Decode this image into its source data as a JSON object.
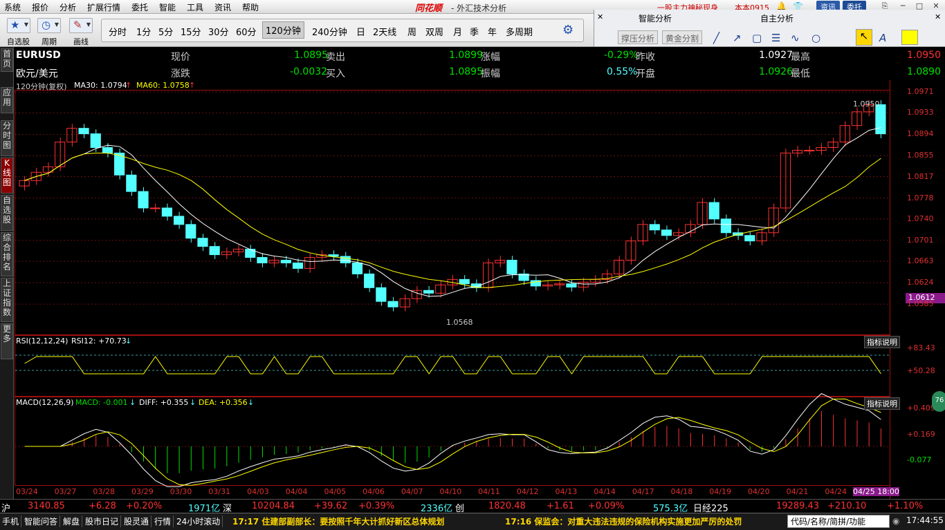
{
  "menu": [
    "系统",
    "报价",
    "分析",
    "扩展行情",
    "委托",
    "智能",
    "工具",
    "资讯",
    "帮助"
  ],
  "brand": "同花顺",
  "window_title": "- 外汇技术分析",
  "promo": "一股主力神秘现身",
  "user": "本本0915",
  "top_buttons": {
    "news": "资讯",
    "trade": "委托"
  },
  "toolbar": {
    "watch": "自选股",
    "period": "周期",
    "draw": "画线"
  },
  "periods": [
    "分时",
    "1分",
    "5分",
    "15分",
    "30分",
    "60分",
    "120分钟",
    "240分钟",
    "日",
    "2天线",
    "周",
    "双周",
    "月",
    "季",
    "年",
    "多周期"
  ],
  "active_period": "120分钟",
  "right_panel": {
    "smart": "智能分析",
    "self": "自主分析",
    "btn1": "撑压分析",
    "btn2": "黄金分割"
  },
  "sidebar": [
    "首页",
    "应用",
    "分时图",
    "K线图",
    "自选股",
    "综合排名",
    "上证指数",
    "更多"
  ],
  "quote": {
    "symbol": "EURUSD",
    "name": "欧元/美元",
    "l_now": "现价",
    "now": "1.0895",
    "l_sell": "卖出",
    "sell": "1.0899",
    "l_chg": "涨幅",
    "chg": "-0.29%",
    "l_prev": "昨收",
    "prev": "1.0927",
    "l_high": "最高",
    "high": "1.0950",
    "l_diff": "涨跌",
    "diff": "-0.0032",
    "l_buy": "买入",
    "buy": "1.0895",
    "l_amp": "振幅",
    "amp": "0.55%",
    "l_open": "开盘",
    "open": "1.0926",
    "l_low": "最低",
    "low": "1.0890"
  },
  "chart": {
    "period_label": "120分钟(复权)",
    "ma30": "MA30: 1.0794",
    "ma60": "MA60: 1.0758",
    "hi_label": "1.0950",
    "lo_label": "1.0568",
    "current_price": "1.0612",
    "colors": {
      "up": "#ff3232",
      "down": "#54ffff",
      "ma30": "#ffffff",
      "ma60": "#ffff00"
    }
  },
  "chart_data": {
    "type": "candlestick",
    "yticks": [
      "1.0971",
      "1.0933",
      "1.0894",
      "1.0855",
      "1.0817",
      "1.0778",
      "1.0740",
      "1.0701",
      "1.0663",
      "1.0624",
      "1.0585"
    ],
    "xticks": [
      "03/24",
      "03/27",
      "03/28",
      "03/29",
      "03/30",
      "03/31",
      "04/03",
      "04/04",
      "04/05",
      "04/06",
      "04/07",
      "04/10",
      "04/11",
      "04/12",
      "04/13",
      "04/14",
      "04/17",
      "04/18",
      "04/19",
      "04/20",
      "04/21",
      "04/24",
      "04/25 18:00"
    ],
    "ylim": [
      1.055,
      1.0975
    ],
    "close": [
      1.081,
      1.0825,
      1.0835,
      1.088,
      1.0905,
      1.0895,
      1.087,
      1.086,
      1.082,
      1.079,
      1.076,
      1.076,
      1.0745,
      1.073,
      1.0705,
      1.069,
      1.0675,
      1.068,
      1.0685,
      1.067,
      1.066,
      1.0665,
      1.066,
      1.065,
      1.067,
      1.0675,
      1.0672,
      1.066,
      1.064,
      1.0615,
      1.059,
      1.058,
      1.0595,
      1.061,
      1.0605,
      1.062,
      1.063,
      1.0622,
      1.0615,
      1.066,
      1.0665,
      1.064,
      1.0628,
      1.0618,
      1.062,
      1.0622,
      1.0616,
      1.0625,
      1.063,
      1.064,
      1.0665,
      1.07,
      1.073,
      1.072,
      1.071,
      1.0715,
      1.073,
      1.077,
      1.074,
      1.0715,
      1.071,
      1.07,
      1.0715,
      1.076,
      1.086,
      1.0865,
      1.0865,
      1.087,
      1.088,
      1.091,
      1.0935,
      1.0948,
      1.0895
    ]
  },
  "rsi": {
    "title": "RSI(12,12,24)",
    "val": "RSI12: +70.73",
    "hi": "+83.43",
    "lo": "+50.28",
    "btn": "指标说明"
  },
  "macd": {
    "title": "MACD(12,26,9)",
    "macd": "MACD: -0.001",
    "diff": "DIFF: +0.355",
    "dea": "DEA: +0.356",
    "top": "+0.409",
    "mid": "+0.169",
    "low": "-0.077",
    "btn": "指标说明",
    "badge": "76"
  },
  "status": {
    "sh": "沪",
    "sh_val": "3140.85",
    "sh_chg": "+6.28",
    "sh_pct": "+0.20%",
    "sh_vol": "1971亿",
    "sz": "深",
    "sz_val": "10204.84",
    "sz_chg": "+39.62",
    "sz_pct": "+0.39%",
    "sz_vol": "2336亿",
    "cy": "创",
    "cy_val": "1820.48",
    "cy_chg": "+1.61",
    "cy_pct": "+0.09%",
    "cy_vol": "575.3亿",
    "rj": "日经225",
    "rj_val": "19289.43",
    "rj_chg": "+210.10",
    "rj_pct": "+1.10%"
  },
  "bottom": {
    "tabs": [
      "手机",
      "智能问答",
      "解盘",
      "股市日记",
      "股灵通",
      "行情",
      "24小时滚动"
    ],
    "news1": "17:17 住建部副部长：要按照千年大计抓好新区总体规划",
    "news2": "17:16 保监会：对重大违法违规的保险机构实施更加严厉的处罚",
    "search": "代码/名称/简拼/功能",
    "time": "17:44:55"
  }
}
